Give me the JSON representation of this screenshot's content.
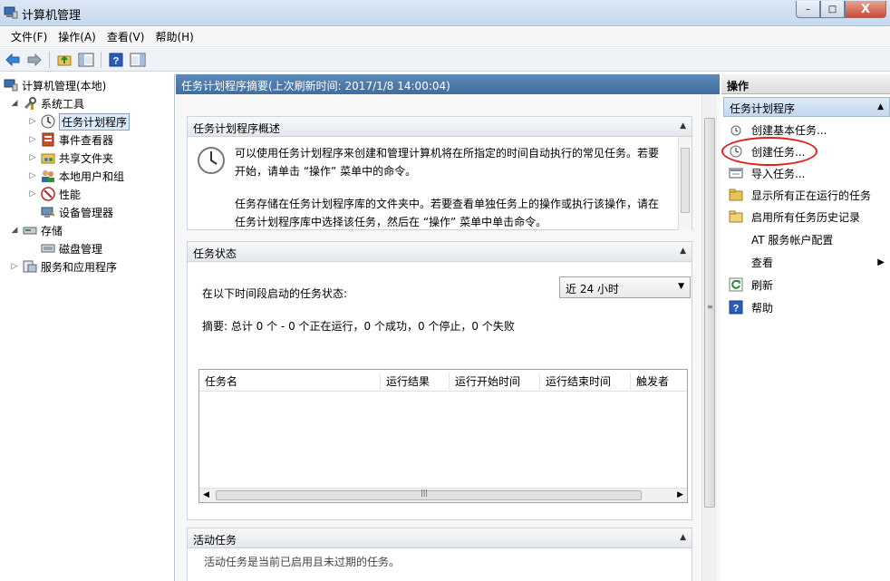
{
  "window": {
    "title": "计算机管理",
    "controls": {
      "minimize": "–",
      "maximize": "□",
      "close": "X"
    }
  },
  "menubar": [
    "文件(F)",
    "操作(A)",
    "查看(V)",
    "帮助(H)"
  ],
  "toolbar": {
    "icons": [
      "back-icon",
      "forward-icon",
      "up-folder-icon",
      "show-hide-tree-icon",
      "help-icon",
      "show-hide-action-pane-icon"
    ]
  },
  "tree": {
    "root": "计算机管理(本地)",
    "items": [
      {
        "label": "系统工具",
        "level": 1,
        "expanded": true
      },
      {
        "label": "任务计划程序",
        "level": 2,
        "selected": true
      },
      {
        "label": "事件查看器",
        "level": 2
      },
      {
        "label": "共享文件夹",
        "level": 2
      },
      {
        "label": "本地用户和组",
        "level": 2
      },
      {
        "label": "性能",
        "level": 2
      },
      {
        "label": "设备管理器",
        "level": 2
      },
      {
        "label": "存储",
        "level": 1,
        "expanded": true
      },
      {
        "label": "磁盘管理",
        "level": 2
      },
      {
        "label": "服务和应用程序",
        "level": 1
      }
    ]
  },
  "main": {
    "header": "任务计划程序摘要(上次刷新时间: 2017/1/8 14:00:04)",
    "overview": {
      "title": "任务计划程序概述",
      "line1": "可以使用任务计划程序来创建和管理计算机将在所指定的时间自动执行的常见任务。若要",
      "line2": "开始，请单击 “操作” 菜单中的命令。",
      "line3": "任务存储在任务计划程序库的文件夹中。若要查看单独任务上的操作或执行该操作，请在",
      "line4": "任务计划程序库中选择该任务，然后在 “操作” 菜单中单击命令。"
    },
    "status": {
      "title": "任务状态",
      "range_label": "在以下时间段启动的任务状态:",
      "range_value": "近 24 小时",
      "summary": "摘要: 总计 0 个 - 0 个正在运行，0 个成功，0 个停止，0 个失败",
      "columns": [
        "任务名",
        "运行结果",
        "运行开始时间",
        "运行结束时间",
        "触发者"
      ]
    },
    "active": {
      "title": "活动任务",
      "text": "活动任务是当前已启用且未过期的任务。"
    }
  },
  "actions": {
    "header": "操作",
    "group": "任务计划程序",
    "items": [
      {
        "label": "创建基本任务...",
        "icon": "create-basic-task-icon"
      },
      {
        "label": "创建任务...",
        "icon": "create-task-icon",
        "highlighted": true
      },
      {
        "label": "导入任务...",
        "icon": "import-task-icon"
      },
      {
        "label": "显示所有正在运行的任务",
        "icon": "running-tasks-icon"
      },
      {
        "label": "启用所有任务历史记录",
        "icon": "history-folder-icon"
      },
      {
        "label": "AT 服务帐户配置",
        "icon": ""
      },
      {
        "label": "查看",
        "icon": "",
        "submenu": true
      },
      {
        "label": "刷新",
        "icon": "refresh-icon"
      },
      {
        "label": "帮助",
        "icon": "help-icon"
      }
    ]
  },
  "colors": {
    "header_blue": "#4a78a8",
    "selection": "#dcebfc",
    "annotation_red": "#e02020"
  }
}
